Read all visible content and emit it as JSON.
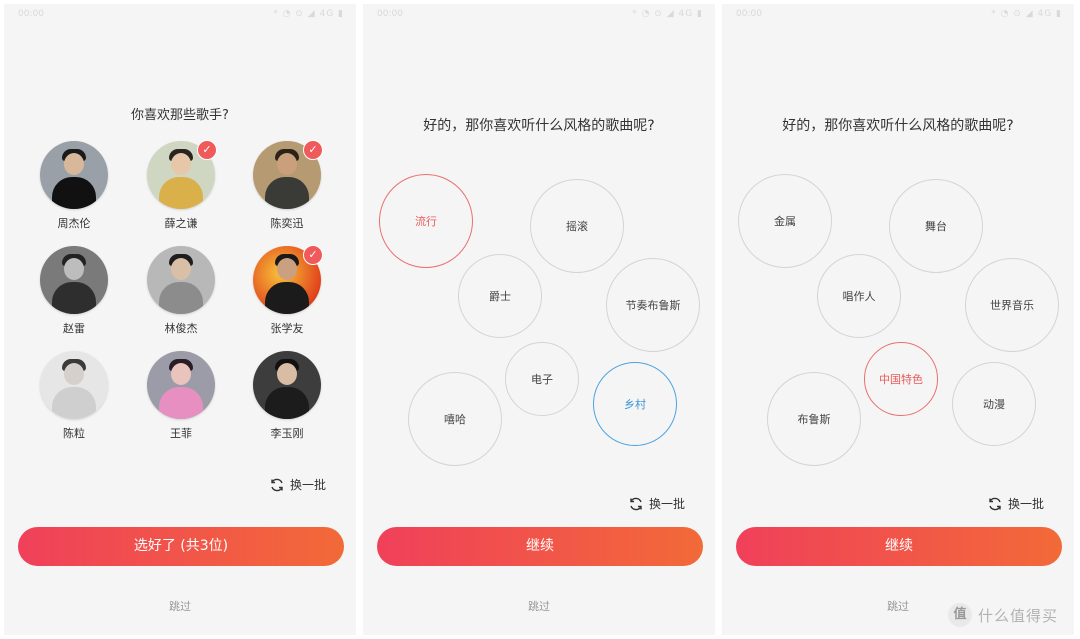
{
  "panel1": {
    "status_time": "00:00",
    "status_indicators": "* ◔ ⊙ ◢ 4G ▮",
    "title": "你喜欢那些歌手?",
    "singers": [
      {
        "name": "周杰伦",
        "selected": false
      },
      {
        "name": "薛之谦",
        "selected": true
      },
      {
        "name": "陈奕迅",
        "selected": true
      },
      {
        "name": "赵雷",
        "selected": false
      },
      {
        "name": "林俊杰",
        "selected": false
      },
      {
        "name": "张学友",
        "selected": true
      },
      {
        "name": "陈粒",
        "selected": false
      },
      {
        "name": "王菲",
        "selected": false
      },
      {
        "name": "李玉刚",
        "selected": false
      }
    ],
    "check_glyph": "✓",
    "refresh_label": "换一批",
    "confirm_label": "选好了 (共3位)",
    "skip_label": "跳过"
  },
  "panel2": {
    "status_time": "00:00",
    "status_indicators": "* ◔ ⊙ ◢ 4G ▮",
    "title": "好的，那你喜欢听什么风格的歌曲呢?",
    "genres": [
      {
        "label": "流行",
        "state": "selected-red"
      },
      {
        "label": "摇滚",
        "state": "normal"
      },
      {
        "label": "爵士",
        "state": "normal"
      },
      {
        "label": "节奏布鲁斯",
        "state": "normal"
      },
      {
        "label": "电子",
        "state": "normal"
      },
      {
        "label": "嘻哈",
        "state": "normal"
      },
      {
        "label": "乡村",
        "state": "selected-blue"
      }
    ],
    "refresh_label": "换一批",
    "continue_label": "继续",
    "skip_label": "跳过"
  },
  "panel3": {
    "status_time": "00:00",
    "status_indicators": "* ◔ ⊙ ◢ 4G ▮",
    "title": "好的，那你喜欢听什么风格的歌曲呢?",
    "genres": [
      {
        "label": "金属",
        "state": "normal"
      },
      {
        "label": "舞台",
        "state": "normal"
      },
      {
        "label": "唱作人",
        "state": "normal"
      },
      {
        "label": "世界音乐",
        "state": "normal"
      },
      {
        "label": "中国特色",
        "state": "selected-red"
      },
      {
        "label": "布鲁斯",
        "state": "normal"
      },
      {
        "label": "动漫",
        "state": "normal"
      }
    ],
    "refresh_label": "换一批",
    "continue_label": "继续",
    "skip_label": "跳过"
  },
  "watermark": {
    "logo": "值",
    "text": "什么值得买"
  },
  "colors": {
    "button_start": "#f0405a",
    "button_end": "#f26a38",
    "selected_red": "#ea5a5a",
    "selected_blue": "#3b93d6",
    "check_badge": "#f05a5a"
  }
}
